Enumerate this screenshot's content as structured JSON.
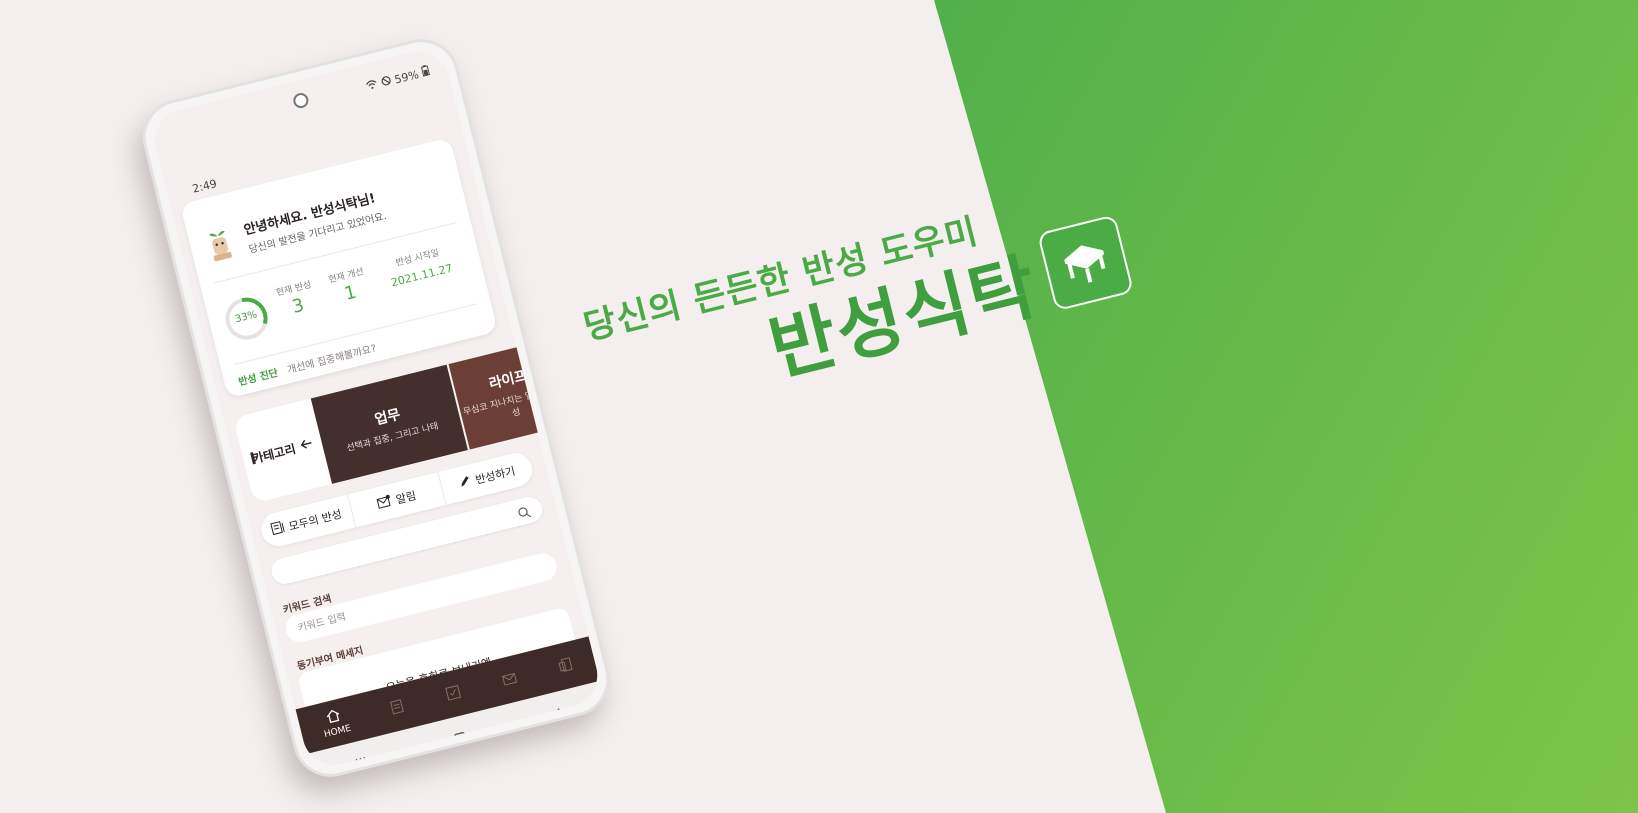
{
  "brand": {
    "tagline": "당신의 든든한 반성 도우미",
    "app_name": "반성식탁"
  },
  "status_bar": {
    "time": "2:49",
    "battery": "59%"
  },
  "profile": {
    "greeting": "안녕하세요. 반성식탁님!",
    "subtitle": "당신의 발전을 기다리고 있었어요."
  },
  "stats": {
    "progress_label": "33%",
    "progress_fraction": 0.33,
    "current_reflection_label": "현재 반성",
    "current_reflection_value": "3",
    "current_improvement_label": "현재 개선",
    "current_improvement_value": "1",
    "start_date_label": "반성 시작일",
    "start_date_value": "2021.11.27"
  },
  "diagnosis": {
    "link": "반성 진단",
    "text": "개선에 집중해볼까요?"
  },
  "categories": {
    "label": "카테고리",
    "items": [
      {
        "title": "업무",
        "subtitle": "선택과 집중, 그리고 나태"
      },
      {
        "title": "라이프",
        "subtitle": "무심코 지나치는 일상 속 반성"
      }
    ]
  },
  "actions": {
    "all_reflections": "모두의 반성",
    "notifications": "알림",
    "write": "반성하기"
  },
  "keyword_search": {
    "label": "키워드 검색",
    "placeholder": "키워드 입력"
  },
  "motivation": {
    "label": "동기부여 메세지",
    "message": "오늘을 후회로 보내기엔,"
  },
  "bottom_nav": {
    "home": "HOME"
  },
  "colors": {
    "brand_green": "#4aab46",
    "dark_brown": "#3e2a26",
    "tile_brown": "#6b3f36"
  }
}
